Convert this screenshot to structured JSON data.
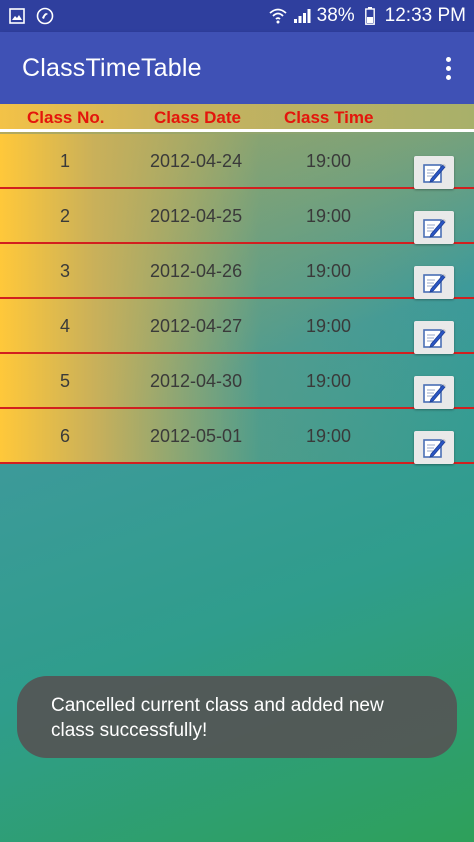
{
  "status_bar": {
    "battery": "38%",
    "time": "12:33 PM",
    "icons": [
      "image-icon",
      "notification-app-icon",
      "wifi-icon",
      "signal-icon",
      "battery-icon"
    ]
  },
  "app_bar": {
    "title": "ClassTimeTable",
    "menu_icon": "more-vertical-icon"
  },
  "table": {
    "headers": {
      "class_no": "Class No.",
      "class_date": "Class Date",
      "class_time": "Class Time"
    },
    "rows": [
      {
        "no": "1",
        "date": "2012-04-24",
        "time": "19:00"
      },
      {
        "no": "2",
        "date": "2012-04-25",
        "time": "19:00"
      },
      {
        "no": "3",
        "date": "2012-04-26",
        "time": "19:00"
      },
      {
        "no": "4",
        "date": "2012-04-27",
        "time": "19:00"
      },
      {
        "no": "5",
        "date": "2012-04-30",
        "time": "19:00"
      },
      {
        "no": "6",
        "date": "2012-05-01",
        "time": "19:00"
      }
    ],
    "row_action_icon": "edit-icon"
  },
  "toast": {
    "message": "Cancelled current class and added new class successfully!"
  },
  "colors": {
    "status_bar": "#2f3f9e",
    "app_bar": "#3f51b5",
    "header_text": "#e4160c",
    "row_divider": "#d21f1f",
    "toast_bg": "#555555"
  }
}
